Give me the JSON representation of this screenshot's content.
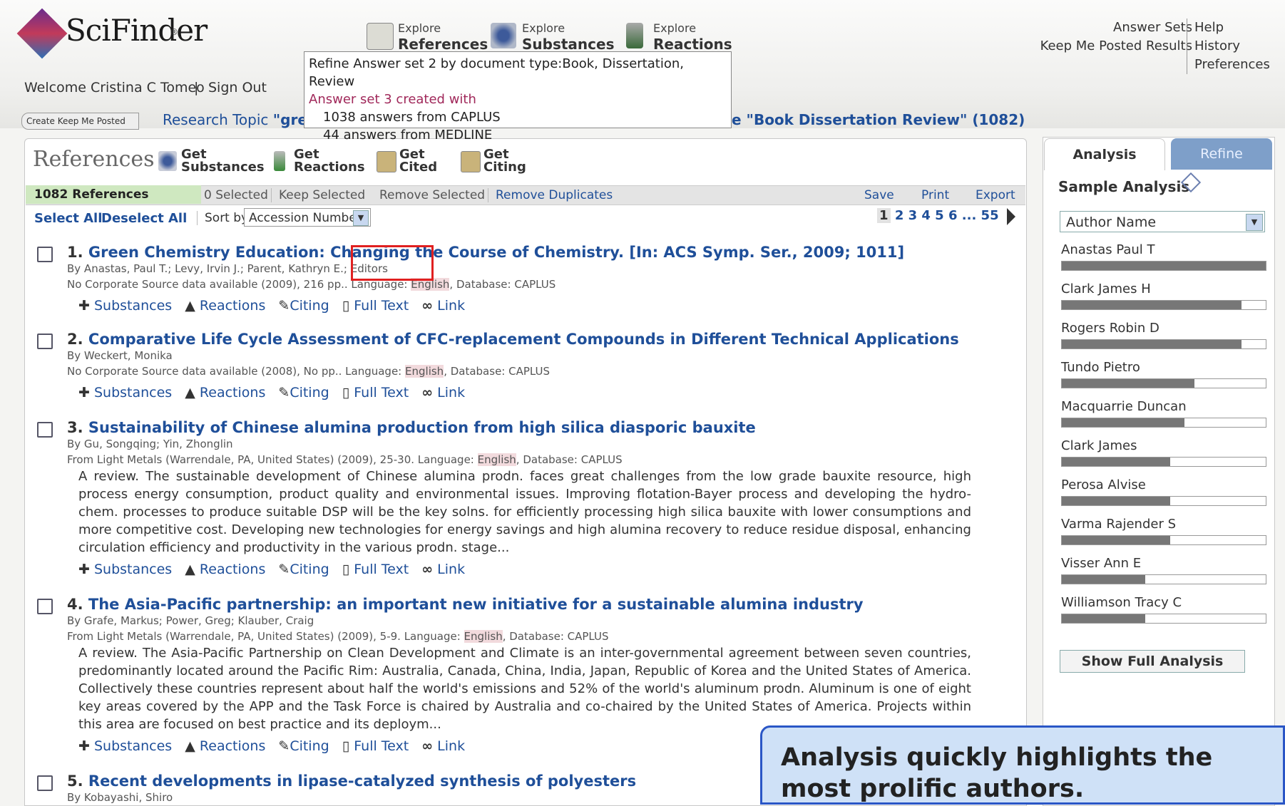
{
  "header": {
    "logo_text": "SciFinder",
    "logo_reg": "®",
    "welcome": "Welcome Cristina C Tomeo",
    "separator": "|",
    "sign_out": "Sign Out",
    "explore": [
      {
        "small": "Explore",
        "big": "References"
      },
      {
        "small": "Explore",
        "big": "Substances"
      },
      {
        "small": "Explore",
        "big": "Reactions"
      }
    ],
    "links_left": [
      "Answer Sets",
      "Keep Me Posted Results"
    ],
    "links_right": [
      "Help",
      "History",
      "Preferences"
    ],
    "kmp_button": "Create Keep Me Posted",
    "research_topic_prefix": "Research Topic ",
    "research_topic_quoted": "\"green",
    "refine_tail": "e \"Book Dissertation Review\" (1082)"
  },
  "tooltip": {
    "line1": "Refine Answer set 2 by document type:Book, Dissertation, Review",
    "line2": "Answer set 3 created with",
    "line3": "1038 answers from CAPLUS",
    "line4": "44 answers from MEDLINE"
  },
  "panel": {
    "title": "References",
    "get_buttons": [
      {
        "l1": "Get",
        "l2": "Substances"
      },
      {
        "l1": "Get",
        "l2": "Reactions"
      },
      {
        "l1": "Get",
        "l2": "Cited"
      },
      {
        "l1": "Get",
        "l2": "Citing"
      }
    ],
    "toolbar": {
      "count": "1082 References",
      "selected": "0 Selected",
      "keep_selected": "Keep Selected",
      "remove_selected": "Remove Selected",
      "remove_duplicates": "Remove Duplicates",
      "save": "Save",
      "print": "Print",
      "export": "Export"
    },
    "select_all": "Select All",
    "deselect_all": "Deselect All",
    "sort_label": "Sort by:",
    "sort_value": "Accession Number",
    "pager": {
      "current": "1",
      "pages": "2 3 4 5 6 ... 55"
    }
  },
  "link_labels": {
    "substances": "Substances",
    "reactions": "Reactions",
    "citing": "Citing",
    "fulltext": "Full Text",
    "link": "Link"
  },
  "results": [
    {
      "num": "1.",
      "title": "Green Chemistry Education: Changing the Course of Chemistry. [In: ACS Symp. Ser., 2009; 1011]",
      "by": "By Anastas, Paul T.; Levy, Irvin J.; Parent, Kathryn E.; Editors",
      "src": "No Corporate Source data available (2009), 216 pp.. Language: English, Database: CAPLUS"
    },
    {
      "num": "2.",
      "title": "Comparative Life Cycle Assessment of CFC-replacement Compounds in Different Technical Applications",
      "by": "By Weckert, Monika",
      "src": "No Corporate Source data available (2008), No pp.. Language: English, Database: CAPLUS"
    },
    {
      "num": "3.",
      "title": "Sustainability of Chinese alumina production from high silica diasporic bauxite",
      "by": "By Gu, Songqing; Yin, Zhonglin",
      "src": "From Light Metals (Warrendale, PA, United States) (2009), 25-30. Language: English, Database: CAPLUS",
      "abstract": "A review.  The sustainable development of Chinese alumina prodn. faces great challenges from the low grade bauxite resource, high process energy consumption, product quality and environmental issues.  Improving flotation-Bayer process and developing the hydro-chem. processes to produce suitable DSP will be the key solns. for efficiently processing high silica bauxite with lower consumptions and more competitive cost.  Developing new technologies for energy savings and high alumina recovery to reduce residue disposal, enhancing circulation efficiency and productivity in the various prodn. stage..."
    },
    {
      "num": "4.",
      "title": "The Asia-Pacific partnership: an important new initiative for a sustainable alumina industry",
      "by": "By Grafe, Markus; Power, Greg; Klauber, Craig",
      "src": "From Light Metals (Warrendale, PA, United States) (2009), 5-9. Language: English, Database: CAPLUS",
      "abstract": "A review.  The Asia-Pacific Partnership on Clean Development and Climate is an inter-governmental agreement between seven countries, predominantly located around the Pacific Rim: Australia, Canada, China, India, Japan, Republic of Korea and the United States of America.  Collectively these countries represent about half the world's emissions and 52% of the world's aluminum prodn.  Aluminum is one of eight key areas covered by the APP and the Task Force is chaired by Australia and co-chaired by the United States of America.  Projects within this area are focused on best practice and its deploym..."
    },
    {
      "num": "5.",
      "title": "Recent developments in lipase-catalyzed synthesis of polyesters",
      "by": "By Kobayashi, Shiro"
    }
  ],
  "analysis": {
    "tab_analysis": "Analysis",
    "tab_refine": "Refine",
    "heading": "Sample Analysis",
    "select_value": "Author Name",
    "authors": [
      {
        "name": "Anastas Paul T",
        "fraction": 1.0
      },
      {
        "name": "Clark James H",
        "fraction": 0.88
      },
      {
        "name": "Rogers Robin D",
        "fraction": 0.88
      },
      {
        "name": "Tundo Pietro",
        "fraction": 0.65
      },
      {
        "name": "Macquarrie Duncan",
        "fraction": 0.6
      },
      {
        "name": "Clark James",
        "fraction": 0.53
      },
      {
        "name": "Perosa Alvise",
        "fraction": 0.53
      },
      {
        "name": "Varma Rajender S",
        "fraction": 0.53
      },
      {
        "name": "Visser Ann E",
        "fraction": 0.41
      },
      {
        "name": "Williamson Tracy C",
        "fraction": 0.41
      }
    ],
    "show_full": "Show Full Analysis"
  },
  "callout": "Analysis quickly highlights the most prolific authors."
}
